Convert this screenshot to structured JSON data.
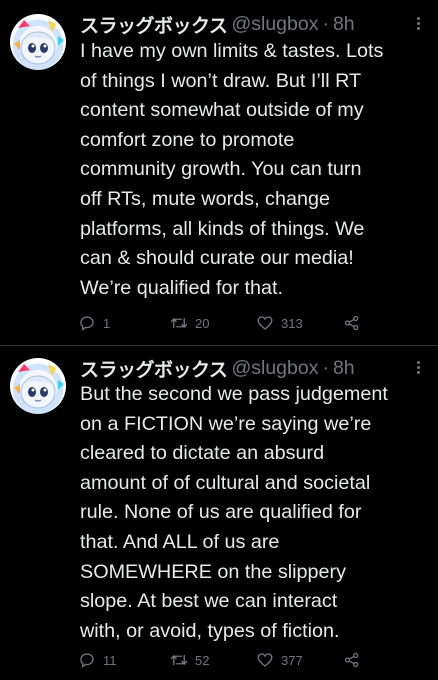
{
  "tweets": [
    {
      "display_name": "スラッグボックス",
      "handle": "@slugbox",
      "separator": "·",
      "time": "8h",
      "text": "I have my own limits & tastes. Lots\nof things I won’t draw. But I’ll RT\ncontent somewhat outside of my\ncomfort zone to promote\ncommunity growth. You can turn\noff RTs, mute words, change\nplatforms, all kinds of things. We\ncan & should curate our media!\nWe’re qualified for that.",
      "replies": "1",
      "retweets": "20",
      "likes": "313"
    },
    {
      "display_name": "スラッグボックス",
      "handle": "@slugbox",
      "separator": "·",
      "time": "8h",
      "text": "But the second we pass judgement\non a FICTION we’re saying we’re\ncleared to dictate an absurd\namount of of cultural and societal\nrule. None of us are qualified for\nthat. And ALL of us are\nSOMEWHERE on the slippery\nslope. At best we can interact\nwith, or avoid, types of fiction.",
      "replies": "11",
      "retweets": "52",
      "likes": "377"
    }
  ],
  "icons": {
    "reply": "reply-icon",
    "retweet": "retweet-icon",
    "like": "heart-icon",
    "share": "share-icon",
    "more": "more-icon"
  },
  "colors": {
    "background": "#000000",
    "text": "#e7e9ea",
    "secondary": "#71767b",
    "divider": "#2f3336"
  }
}
